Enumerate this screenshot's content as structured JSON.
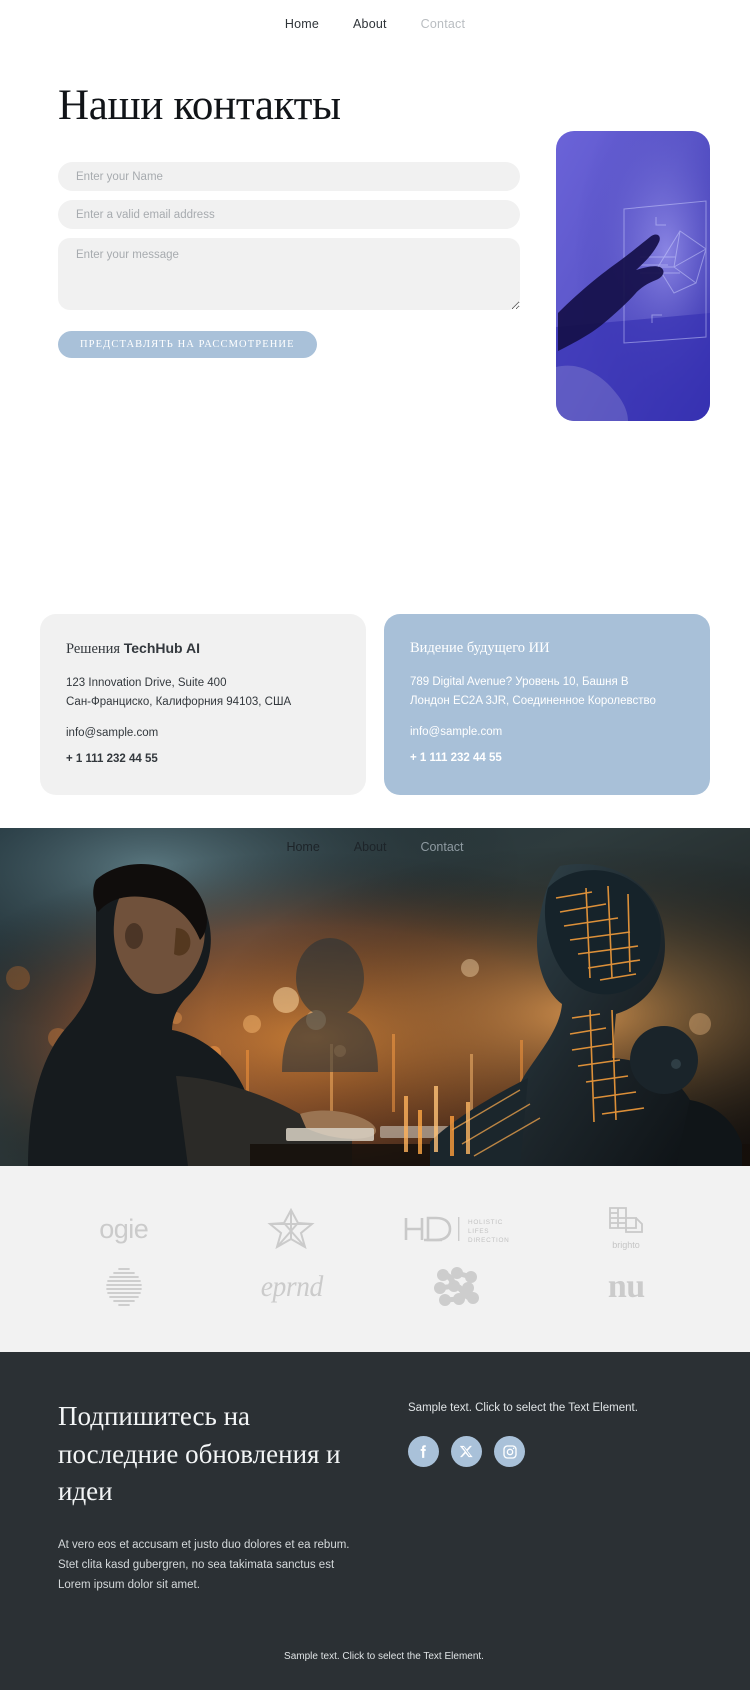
{
  "nav": {
    "items": [
      {
        "label": "Home",
        "muted": false
      },
      {
        "label": "About",
        "muted": false
      },
      {
        "label": "Contact",
        "muted": true
      }
    ]
  },
  "hero": {
    "title": "Наши контакты",
    "form": {
      "name_placeholder": "Enter your Name",
      "name_value": "",
      "email_placeholder": "Enter a valid email address",
      "email_value": "",
      "message_placeholder": "Enter your message",
      "message_value": "",
      "submit_label": "ПРЕДСТАВЛЯТЬ НА РАССМОТРЕНИЕ"
    },
    "image_alt": "hand-touching-holographic-interface"
  },
  "cards": [
    {
      "title_prefix": "Решения",
      "title_brand": "TechHub AI",
      "address_line1": "123 Innovation Drive, Suite 400",
      "address_line2": "Сан-Франциско, Калифорния 94103, США",
      "email": "info@sample.com",
      "phone": "+ 1 111 232 44 55"
    },
    {
      "title_prefix": "Видение будущего ИИ",
      "title_brand": "",
      "address_line1": "789 Digital Avenue? Уровень 10, Башня В",
      "address_line2": "Лондон EC2A 3JR, Соединенное Королевство",
      "email": "info@sample.com",
      "phone": "+ 1 111 232 44 55"
    }
  ],
  "band": {
    "nav": [
      {
        "label": "Home",
        "muted": false
      },
      {
        "label": "About",
        "muted": false
      },
      {
        "label": "Contact",
        "muted": true
      }
    ],
    "image_alt": "woman-typing-beside-robot"
  },
  "logos": {
    "row1": [
      {
        "name": "ogie",
        "type": "wordmark"
      },
      {
        "name": "star-flower",
        "type": "mark"
      },
      {
        "name": "HD",
        "type": "hd",
        "sub1": "HOLISTIC",
        "sub2": "LIFES",
        "sub3": "DIRECTION"
      },
      {
        "name": "brighto",
        "type": "brighto"
      }
    ],
    "row2": [
      {
        "name": "striped-sphere",
        "type": "mark"
      },
      {
        "name": "eprnd",
        "type": "wordmark"
      },
      {
        "name": "dot-cluster",
        "type": "mark"
      },
      {
        "name": "nu",
        "type": "wordmark"
      }
    ]
  },
  "footer": {
    "heading": "Подпишитесь на последние обновления и идеи",
    "body": "At vero eos et accusam et justo duo dolores et ea rebum. Stet clita kasd gubergren, no sea takimata sanctus est Lorem ipsum dolor sit amet.",
    "sample_text": "Sample text. Click to select the Text Element.",
    "socials": [
      {
        "name": "facebook",
        "glyph": "f"
      },
      {
        "name": "x-twitter",
        "glyph": "X"
      },
      {
        "name": "instagram",
        "glyph": "camera"
      }
    ],
    "bottom_text": "Sample text. Click to select the Text Element."
  },
  "colors": {
    "accent_blue": "#a8c0d8",
    "field_grey": "#f1f1f1",
    "footer_dark": "#2b3034",
    "logo_grey": "#c9c9c9"
  }
}
